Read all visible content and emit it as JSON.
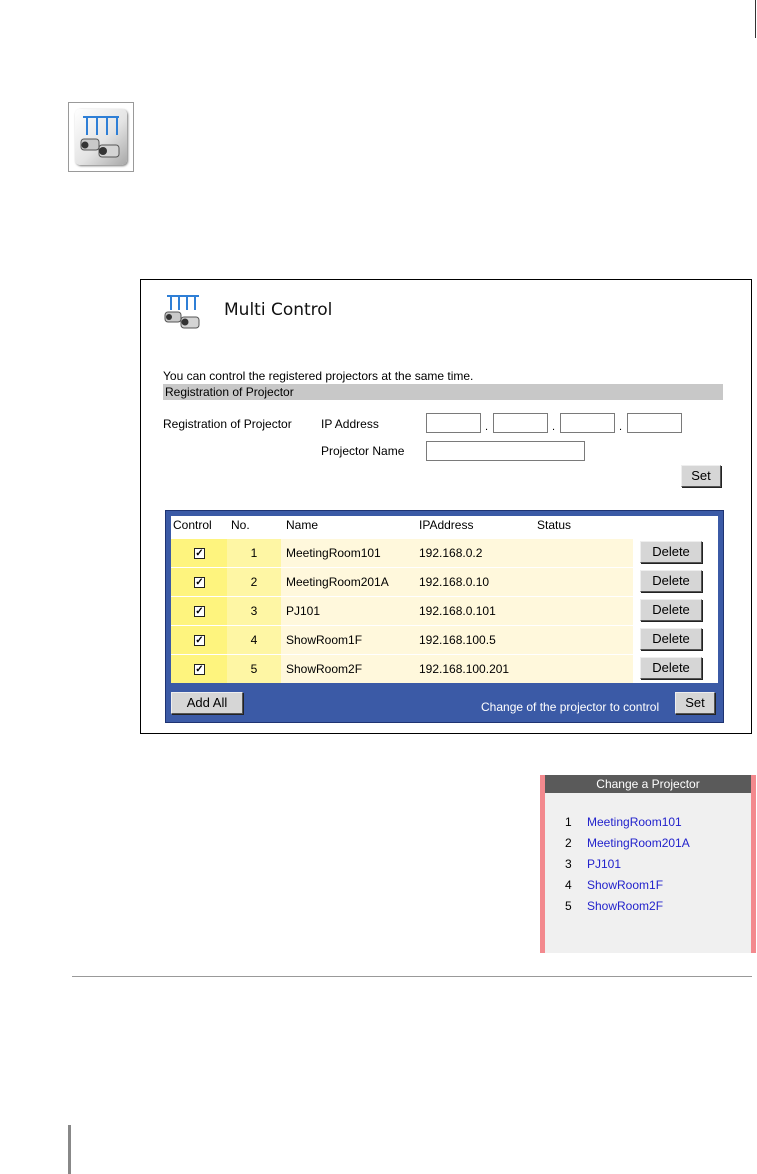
{
  "panel": {
    "title": "Multi Control",
    "description": "You can control the registered projectors at the same time.",
    "registration_header": "Registration of Projector",
    "registration_label": "Registration of Projector",
    "ip_address_label": "IP Address",
    "projector_name_label": "Projector Name",
    "ip_octets": [
      "",
      "",
      "",
      ""
    ],
    "projector_name_value": "",
    "set_label": "Set"
  },
  "table": {
    "headers": {
      "control": "Control",
      "no": "No.",
      "name": "Name",
      "ip": "IPAddress",
      "status": "Status"
    },
    "rows": [
      {
        "checked": true,
        "no": "1",
        "name": "MeetingRoom101",
        "ip": "192.168.0.2",
        "status": "",
        "delete_label": "Delete"
      },
      {
        "checked": true,
        "no": "2",
        "name": "MeetingRoom201A",
        "ip": "192.168.0.10",
        "status": "",
        "delete_label": "Delete"
      },
      {
        "checked": true,
        "no": "3",
        "name": "PJ101",
        "ip": "192.168.0.101",
        "status": "",
        "delete_label": "Delete"
      },
      {
        "checked": true,
        "no": "4",
        "name": "ShowRoom1F",
        "ip": "192.168.100.5",
        "status": "",
        "delete_label": "Delete"
      },
      {
        "checked": true,
        "no": "5",
        "name": "ShowRoom2F",
        "ip": "192.168.100.201",
        "status": "",
        "delete_label": "Delete"
      }
    ],
    "add_all_label": "Add All",
    "change_label": "Change of the projector to control",
    "set_label": "Set"
  },
  "side": {
    "header": "Change a Projector",
    "items": [
      {
        "no": "1",
        "name": "MeetingRoom101"
      },
      {
        "no": "2",
        "name": "MeetingRoom201A"
      },
      {
        "no": "3",
        "name": "PJ101"
      },
      {
        "no": "4",
        "name": "ShowRoom1F"
      },
      {
        "no": "5",
        "name": "ShowRoom2F"
      }
    ]
  },
  "colors": {
    "table_frame": "#3b5aa6",
    "control_cell": "#fef47e",
    "row_cell": "#fff8dc",
    "side_border": "#f3898e",
    "link": "#2222cc"
  },
  "icons": {
    "big": "multi-projector-icon",
    "panel": "multi-projector-icon"
  }
}
